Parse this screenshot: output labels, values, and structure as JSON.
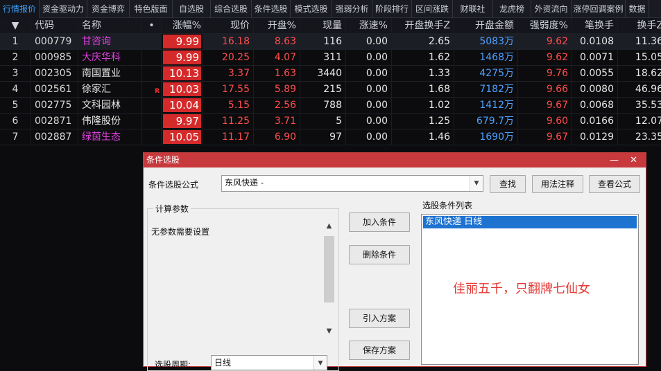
{
  "tabs": [
    "行情报价",
    "资金驱动力",
    "资金博弈",
    "特色版面",
    "自选股",
    "综合选股",
    "条件选股",
    "模式选股",
    "强弱分析",
    "阶段排行",
    "区间涨跌",
    "财联社",
    "龙虎榜",
    "外资流向",
    "涨停回调案例",
    "数据"
  ],
  "table": {
    "header": {
      "sort_icon": "▼",
      "code": "代码",
      "name": "名称",
      "dot": "•",
      "zf": "涨幅%",
      "xj": "现价",
      "kp": "开盘%",
      "xl": "现量",
      "zs": "涨速%",
      "kh": "开盘换手Z",
      "ke": "开盘金额",
      "qr": "强弱度%",
      "bh": "笔换手",
      "hs": "换手Z"
    },
    "rows": [
      {
        "idx": "1",
        "code": "000779",
        "name": "甘咨询",
        "name_color": "magenta",
        "badge": "",
        "zf": "9.99",
        "xj": "16.18",
        "kp": "8.63",
        "xl": "116",
        "zs": "0.00",
        "kh": "2.65",
        "ke": "5083万",
        "qr": "9.62",
        "bh": "0.0108",
        "hs": "11.36"
      },
      {
        "idx": "2",
        "code": "000985",
        "name": "大庆华科",
        "name_color": "magenta",
        "badge": "",
        "zf": "9.99",
        "xj": "20.25",
        "kp": "4.07",
        "xl": "311",
        "zs": "0.00",
        "kh": "1.62",
        "ke": "1468万",
        "qr": "9.62",
        "bh": "0.0071",
        "hs": "15.05"
      },
      {
        "idx": "3",
        "code": "002305",
        "name": "南国置业",
        "name_color": "white",
        "badge": "",
        "zf": "10.13",
        "xj": "3.37",
        "kp": "1.63",
        "xl": "3440",
        "zs": "0.00",
        "kh": "1.33",
        "ke": "4275万",
        "qr": "9.76",
        "bh": "0.0055",
        "hs": "18.62"
      },
      {
        "idx": "4",
        "code": "002561",
        "name": "徐家汇",
        "name_color": "white",
        "badge": "R",
        "zf": "10.03",
        "xj": "17.55",
        "kp": "5.89",
        "xl": "215",
        "zs": "0.00",
        "kh": "1.68",
        "ke": "7182万",
        "qr": "9.66",
        "bh": "0.0080",
        "hs": "46.96"
      },
      {
        "idx": "5",
        "code": "002775",
        "name": "文科园林",
        "name_color": "white",
        "badge": "",
        "zf": "10.04",
        "xj": "5.15",
        "kp": "2.56",
        "xl": "788",
        "zs": "0.00",
        "kh": "1.02",
        "ke": "1412万",
        "qr": "9.67",
        "bh": "0.0068",
        "hs": "35.53"
      },
      {
        "idx": "6",
        "code": "002871",
        "name": "伟隆股份",
        "name_color": "white",
        "badge": "",
        "zf": "9.97",
        "xj": "11.25",
        "kp": "3.71",
        "xl": "5",
        "zs": "0.00",
        "kh": "1.25",
        "ke": "679.7万",
        "qr": "9.60",
        "bh": "0.0166",
        "hs": "12.07"
      },
      {
        "idx": "7",
        "code": "002887",
        "name": "绿茵生态",
        "name_color": "magenta",
        "badge": "",
        "zf": "10.05",
        "xj": "11.17",
        "kp": "6.90",
        "xl": "97",
        "zs": "0.00",
        "kh": "1.46",
        "ke": "1690万",
        "qr": "9.67",
        "bh": "0.0129",
        "hs": "23.35"
      }
    ]
  },
  "dialog": {
    "title": "条件选股",
    "controls": "— ✕",
    "formula_label": "条件选股公式",
    "formula_value": "东风快递      -",
    "btn_find": "查找",
    "btn_usage": "用法注释",
    "btn_view": "查看公式",
    "params_title": "计算参数",
    "params_text": "无参数需要设置",
    "btn_add": "加入条件",
    "btn_delete": "删除条件",
    "btn_import": "引入方案",
    "btn_save": "保存方案",
    "list_title": "选股条件列表",
    "list_item": "东风快递   日线",
    "red_note": "佳丽五千，只翻牌七仙女",
    "period_label": "选股周期:",
    "period_value": "日线",
    "scroll_up": "▲",
    "scroll_down": "▼"
  },
  "colors": {
    "accent": "#3aa0ff",
    "rise": "#ff4d4d",
    "magenta": "#e040e0",
    "amount": "#4ea0ff",
    "zf_bg": "#d42a2a",
    "dialog_title": "#c7393d",
    "selection": "#1e73d1"
  }
}
